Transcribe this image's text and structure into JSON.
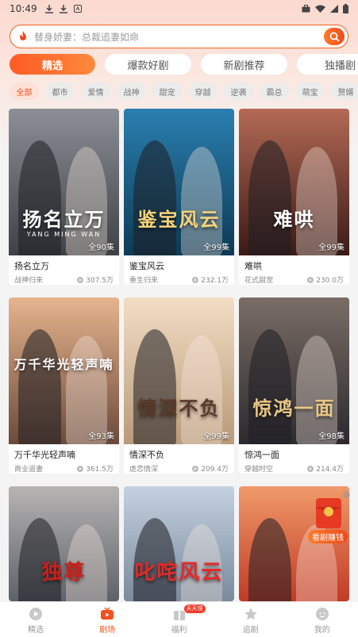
{
  "status": {
    "time": "10:49"
  },
  "search": {
    "placeholder": "替身娇妻：总裁追妻如命"
  },
  "tabs": [
    "精选",
    "爆款好剧",
    "新剧推荐",
    "独播剧"
  ],
  "categories": [
    "全部",
    "都市",
    "爱情",
    "战神",
    "甜宠",
    "穿越",
    "逆袭",
    "霸总",
    "萌宝",
    "赘婿"
  ],
  "dramas": [
    {
      "name": "扬名立万",
      "genre": "战神归来",
      "views": "307.5万",
      "episodes": "全90集",
      "poster_text": "扬名立万",
      "poster_sub": "YANG  MING  WAN",
      "bg1": "#3e4246",
      "bg2": "#8b8f96",
      "title_color": "#ffffff"
    },
    {
      "name": "鉴宝风云",
      "genre": "重生归来",
      "views": "232.1万",
      "episodes": "全99集",
      "poster_text": "鉴宝风云",
      "bg1": "#0d3a55",
      "bg2": "#2a7fb0",
      "title_color": "#f6d37a"
    },
    {
      "name": "难哄",
      "genre": "花式甜宠",
      "views": "230.0万",
      "episodes": "全99集",
      "poster_text": "难哄",
      "bg1": "#3a1a16",
      "bg2": "#b46a55",
      "title_color": "#ffffff"
    },
    {
      "name": "万千华光轻声喃",
      "genre": "商业追妻",
      "views": "361.5万",
      "episodes": "全93集",
      "poster_text": "万千华光轻声喃",
      "bg1": "#6b4a3a",
      "bg2": "#e6b48e",
      "title_color": "#ffffff"
    },
    {
      "name": "情深不负",
      "genre": "虐恋情深",
      "views": "209.4万",
      "episodes": "全99集",
      "poster_text": "情深不负",
      "bg1": "#b99a7a",
      "bg2": "#f2ddc4",
      "title_color": "#5a3a2a"
    },
    {
      "name": "惊鸿一面",
      "genre": "穿越时空",
      "views": "214.4万",
      "episodes": "全98集",
      "poster_text": "惊鸿一面",
      "bg1": "#2c2a2e",
      "bg2": "#7a6d66",
      "title_color": "#e9c885"
    },
    {
      "name": "",
      "genre": "",
      "views": "",
      "episodes": "",
      "poster_text": "独尊",
      "bg1": "#5d6169",
      "bg2": "#b7b4b3",
      "title_color": "#c8201c"
    },
    {
      "name": "",
      "genre": "",
      "views": "",
      "episodes": "",
      "poster_text": "叱咤风云",
      "bg1": "#7a8a9c",
      "bg2": "#c4d1e0",
      "title_color": "#e22a2a"
    },
    {
      "name": "",
      "genre": "",
      "views": "",
      "episodes": "",
      "poster_text": "",
      "bg1": "#c23a25",
      "bg2": "#f09a6a",
      "title_color": "#ffffff"
    }
  ],
  "float_ad": {
    "label": "看剧赚钱"
  },
  "bottom_nav": [
    {
      "label": "精选",
      "icon": "play-circle-icon"
    },
    {
      "label": "剧场",
      "icon": "tv-icon"
    },
    {
      "label": "福利",
      "icon": "gift-icon",
      "badge": "天天领"
    },
    {
      "label": "追剧",
      "icon": "star-icon"
    },
    {
      "label": "我的",
      "icon": "profile-icon"
    }
  ],
  "colors": {
    "accent": "#f2501e",
    "accent_light": "#ff8a3d"
  }
}
